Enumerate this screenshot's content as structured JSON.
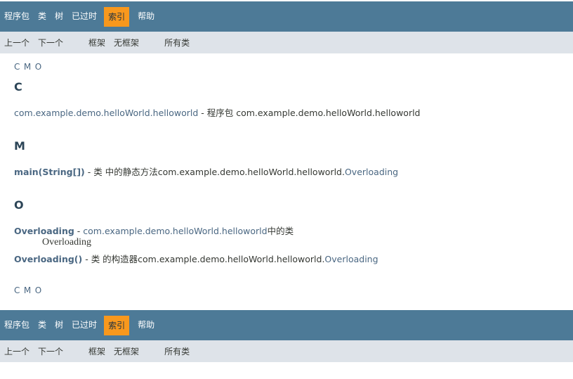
{
  "nav": {
    "items": [
      "程序包",
      "类",
      "树",
      "已过时",
      "索引",
      "帮助"
    ],
    "active_index": 4
  },
  "subnav": {
    "prev": "上一个",
    "next": "下一个",
    "frames": "框架",
    "no_frames": "无框架",
    "all_classes": "所有类"
  },
  "letters": [
    "C",
    "M",
    "O"
  ],
  "sections": {
    "c": {
      "title": "C",
      "link": "com.example.demo.helloWorld.helloworld",
      "desc": " - 程序包 com.example.demo.helloWorld.helloworld"
    },
    "m": {
      "title": "M",
      "link": "main(String[])",
      "desc": " - 类 中的静态方法com.example.demo.helloWorld.helloworld.",
      "class_link": "Overloading"
    },
    "o": {
      "title": "O",
      "entry1_link": "Overloading",
      "entry1_sep": " - ",
      "entry1_pkg_link": "com.example.demo.helloWorld.helloworld",
      "entry1_suffix": "中的类",
      "entry1_desc": "Overloading",
      "entry2_link": "Overloading()",
      "entry2_desc": " - 类 的构造器com.example.demo.helloWorld.helloworld.",
      "entry2_class_link": "Overloading"
    }
  },
  "colors": {
    "nav_bg": "#4D7A97",
    "active_bg": "#F8981D",
    "subnav_bg": "#DEE3E9",
    "link": "#4A6782"
  }
}
